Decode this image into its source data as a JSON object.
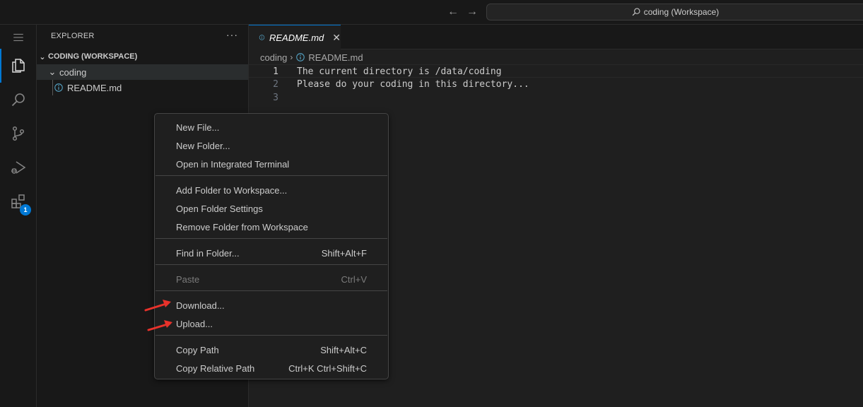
{
  "titlebar": {
    "search_text": "coding (Workspace)",
    "back_icon": "arrow-left-icon",
    "forward_icon": "arrow-right-icon"
  },
  "activitybar": {
    "items": [
      "menu-icon",
      "explorer-icon",
      "search-icon",
      "source-control-icon",
      "run-debug-icon",
      "extensions-icon"
    ],
    "extensions_badge": "1",
    "accent": "#0078d4"
  },
  "sidebar": {
    "title": "EXPLORER",
    "more": "···",
    "section": "CODING (WORKSPACE)",
    "folder": "coding",
    "file": "README.md"
  },
  "editor": {
    "tab_label": "README.md",
    "tab_close": "✕",
    "breadcrumb": [
      "coding",
      "README.md"
    ],
    "lines": [
      {
        "num": "1",
        "text": "The current directory is /data/coding"
      },
      {
        "num": "2",
        "text": "Please do your coding in this directory..."
      },
      {
        "num": "3",
        "text": ""
      }
    ]
  },
  "context_menu": {
    "groups": [
      [
        {
          "label": "New File...",
          "shortcut": ""
        },
        {
          "label": "New Folder...",
          "shortcut": ""
        },
        {
          "label": "Open in Integrated Terminal",
          "shortcut": ""
        }
      ],
      [
        {
          "label": "Add Folder to Workspace...",
          "shortcut": ""
        },
        {
          "label": "Open Folder Settings",
          "shortcut": ""
        },
        {
          "label": "Remove Folder from Workspace",
          "shortcut": ""
        }
      ],
      [
        {
          "label": "Find in Folder...",
          "shortcut": "Shift+Alt+F"
        }
      ],
      [
        {
          "label": "Paste",
          "shortcut": "Ctrl+V",
          "disabled": true
        }
      ],
      [
        {
          "label": "Download...",
          "shortcut": ""
        },
        {
          "label": "Upload...",
          "shortcut": ""
        }
      ],
      [
        {
          "label": "Copy Path",
          "shortcut": "Shift+Alt+C"
        },
        {
          "label": "Copy Relative Path",
          "shortcut": "Ctrl+K Ctrl+Shift+C"
        }
      ]
    ]
  },
  "annotations": {
    "arrow_color": "#e8322b"
  }
}
